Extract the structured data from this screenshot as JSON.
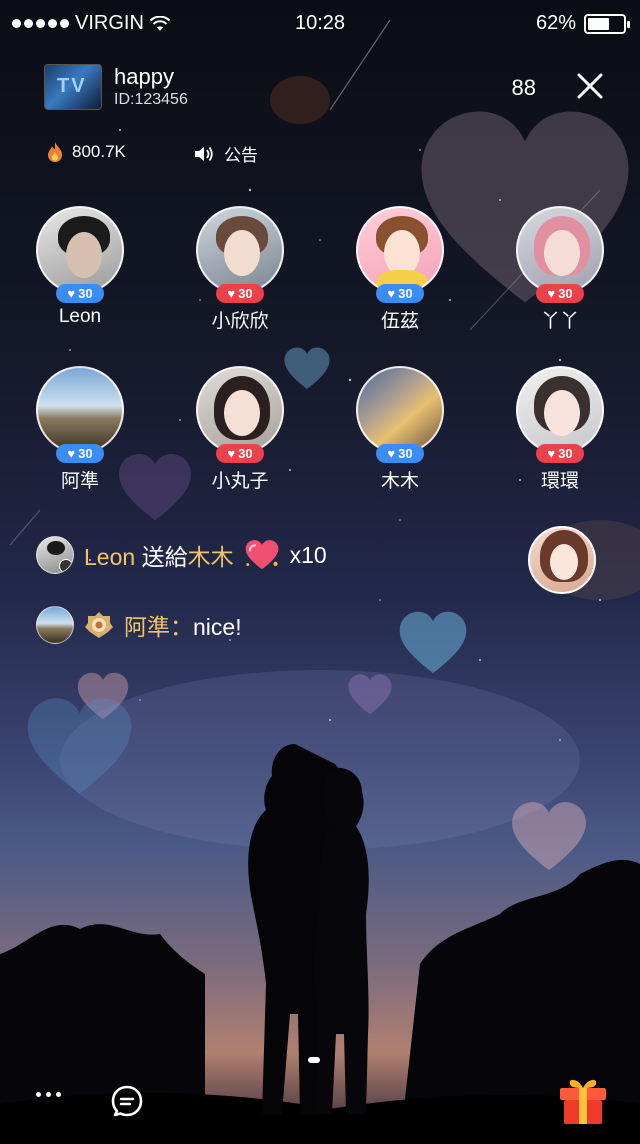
{
  "status_bar": {
    "carrier": "VIRGIN",
    "time": "10:28",
    "battery_percent": "62%",
    "battery_level": 0.62,
    "signal_icon": "signal-dots-icon",
    "wifi_icon": "wifi-icon"
  },
  "header": {
    "room_title": "happy",
    "room_id": "ID:123456",
    "viewer_count": "88",
    "close_icon": "close-icon"
  },
  "info": {
    "hot_value": "800.7K",
    "notice_label": "公告"
  },
  "guests": [
    {
      "name": "Leon",
      "likes": "30",
      "badge": "blue"
    },
    {
      "name": "小欣欣",
      "likes": "30",
      "badge": "red"
    },
    {
      "name": "伍茲",
      "likes": "30",
      "badge": "blue"
    },
    {
      "name": "丫丫",
      "likes": "30",
      "badge": "red"
    },
    {
      "name": "阿準",
      "likes": "30",
      "badge": "blue"
    },
    {
      "name": "小丸子",
      "likes": "30",
      "badge": "red"
    },
    {
      "name": "木木",
      "likes": "30",
      "badge": "blue"
    },
    {
      "name": "環環",
      "likes": "30",
      "badge": "red"
    }
  ],
  "chat": {
    "gift": {
      "sender": "Leon",
      "verb": "送給",
      "receiver": "木木",
      "count": "x10"
    },
    "message": {
      "sender": "阿準：",
      "text": "nice!"
    }
  },
  "colors": {
    "badge_blue": "#3a8df3",
    "badge_red": "#e9424a",
    "username_gold": "#f1c36a"
  }
}
